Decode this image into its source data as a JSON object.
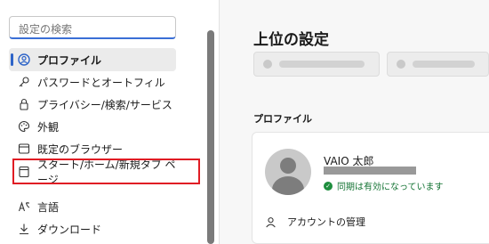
{
  "sidebar": {
    "search_placeholder": "設定の検索",
    "items": [
      {
        "label": "プロファイル",
        "icon": "profile-icon"
      },
      {
        "label": "パスワードとオートフィル",
        "icon": "key-icon"
      },
      {
        "label": "プライバシー/検索/サービス",
        "icon": "lock-icon"
      },
      {
        "label": "外観",
        "icon": "palette-icon"
      },
      {
        "label": "既定のブラウザー",
        "icon": "browser-icon"
      },
      {
        "label": "スタート/ホーム/新規タブ ページ",
        "icon": "home-page-icon"
      },
      {
        "label": "言語",
        "icon": "language-icon"
      },
      {
        "label": "ダウンロード",
        "icon": "download-icon"
      }
    ]
  },
  "main": {
    "title": "上位の設定",
    "section_title": "プロファイル",
    "profile": {
      "name": "VAIO 太郎",
      "sync_status": "同期は有効になっています",
      "manage_label": "アカウントの管理"
    }
  },
  "colors": {
    "accent": "#2e64c8",
    "highlight": "#e01c24",
    "sync_green": "#137333"
  }
}
